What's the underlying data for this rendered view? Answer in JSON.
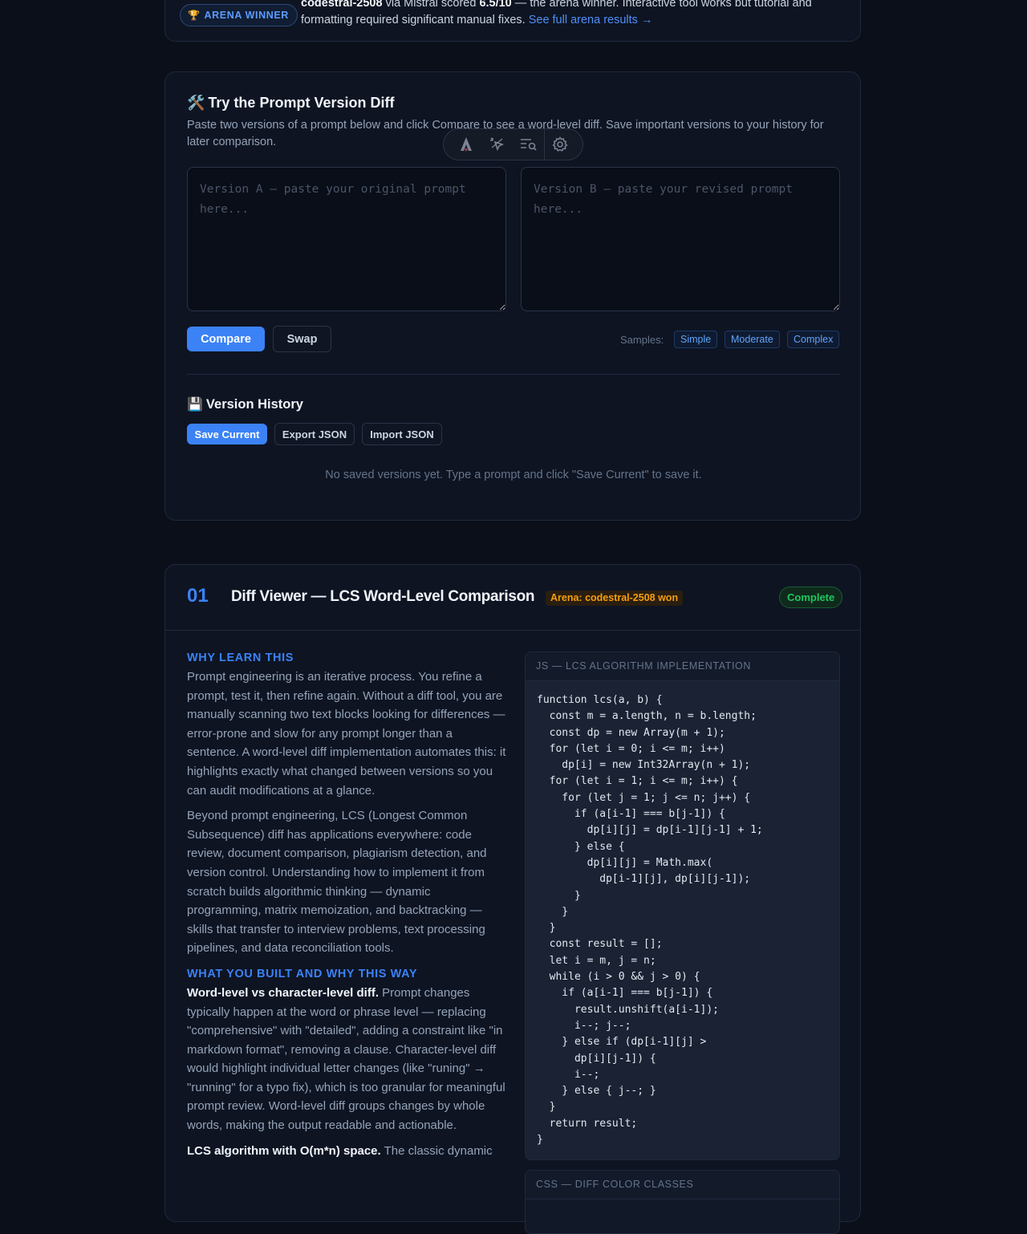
{
  "arena": {
    "badge_label": "ARENA WINNER",
    "model": "codestral-2508",
    "via": " via Mistral scored ",
    "score": "6.5/10",
    "rest": " — the arena winner. Interactive tool works but tutorial and formatting required significant manual fixes. ",
    "link": "See full arena results →"
  },
  "try_card": {
    "title": "Try the Prompt Version Diff",
    "subtitle": "Paste two versions of a prompt below and click Compare to see a word-level diff. Save important versions to your history for later comparison.",
    "version_a_placeholder": "Version A — paste your original prompt here...",
    "version_b_placeholder": "Version B — paste your revised prompt here...",
    "compare_label": "Compare",
    "swap_label": "Swap",
    "samples_label": "Samples:",
    "samples": [
      "Simple",
      "Moderate",
      "Complex"
    ],
    "history_title": "Version History",
    "save_label": "Save Current",
    "export_label": "Export JSON",
    "import_label": "Import JSON",
    "empty_text": "No saved versions yet. Type a prompt and click \"Save Current\" to save it."
  },
  "section": {
    "number": "01",
    "title": "Diff Viewer — LCS Word-Level Comparison",
    "arena_tag": "Arena: codestral-2508 won",
    "status": "Complete",
    "why_heading": "WHY LEARN THIS",
    "why_p1": "Prompt engineering is an iterative process. You refine a prompt, test it, then refine again. Without a diff tool, you are manually scanning two text blocks looking for differences — error-prone and slow for any prompt longer than a sentence. A word-level diff implementation automates this: it highlights exactly what changed between versions so you can audit modifications at a glance.",
    "why_p2": "Beyond prompt engineering, LCS (Longest Common Subsequence) diff has applications everywhere: code review, document comparison, plagiarism detection, and version control. Understanding how to implement it from scratch builds algorithmic thinking — dynamic programming, matrix memoization, and backtracking — skills that transfer to interview problems, text processing pipelines, and data reconciliation tools.",
    "built_heading": "WHAT YOU BUILT AND WHY THIS WAY",
    "built_p1_bold": "Word-level vs character-level diff.",
    "built_p1": " Prompt changes typically happen at the word or phrase level — replacing \"comprehensive\" with \"detailed\", adding a constraint like \"in markdown format\", removing a clause. Character-level diff would highlight individual letter changes (like \"runing\" → \"running\" for a typo fix), which is too granular for meaningful prompt review. Word-level diff groups changes by whole words, making the output readable and actionable.",
    "built_p2_bold": "LCS algorithm with O(m*n) space.",
    "built_p2": " The classic dynamic",
    "code1_label": "JS — LCS ALGORITHM IMPLEMENTATION",
    "code1": "function lcs(a, b) {\n  const m = a.length, n = b.length;\n  const dp = new Array(m + 1);\n  for (let i = 0; i <= m; i++)\n    dp[i] = new Int32Array(n + 1);\n  for (let i = 1; i <= m; i++) {\n    for (let j = 1; j <= n; j++) {\n      if (a[i-1] === b[j-1]) {\n        dp[i][j] = dp[i-1][j-1] + 1;\n      } else {\n        dp[i][j] = Math.max(\n          dp[i-1][j], dp[i][j-1]);\n      }\n    }\n  }\n  const result = [];\n  let i = m, j = n;\n  while (i > 0 && j > 0) {\n    if (a[i-1] === b[j-1]) {\n      result.unshift(a[i-1]);\n      i--; j--;\n    } else if (dp[i-1][j] >\n      dp[i][j-1]) {\n      i--;\n    } else { j--; }\n  }\n  return result;\n}",
    "code2_label": "CSS — DIFF COLOR CLASSES"
  },
  "icons": {
    "trophy": "trophy-icon",
    "tools": "hammer-wrench-icon",
    "floppy": "floppy-disk-icon"
  },
  "colors": {
    "accent": "#3b82f6",
    "arena": "#f59e0b",
    "complete": "#22c55e"
  }
}
